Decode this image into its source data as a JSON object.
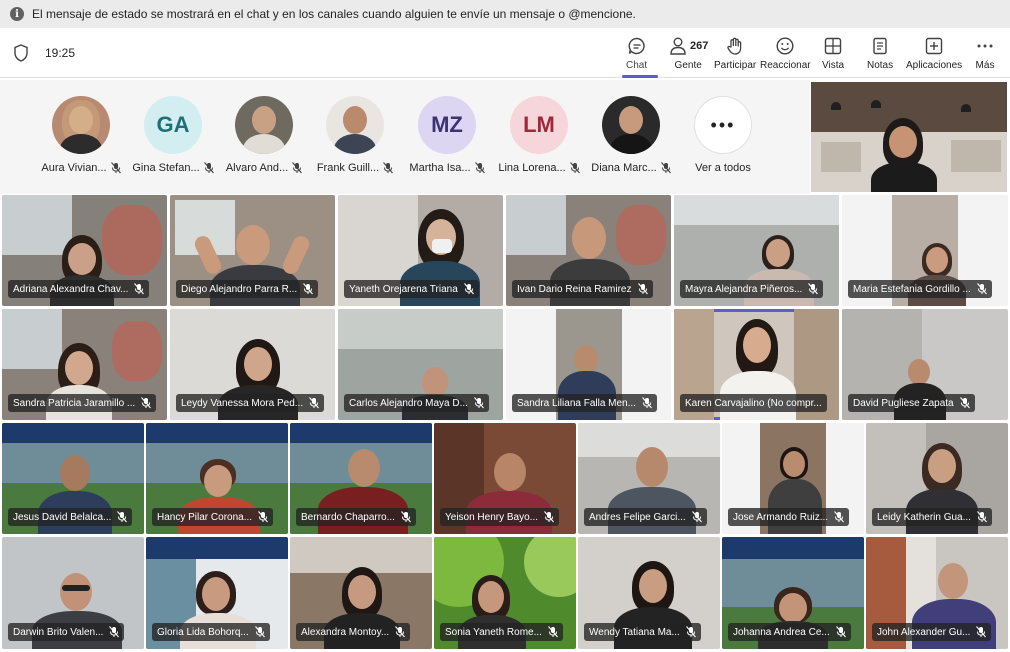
{
  "banner": {
    "text": "El mensaje de estado se mostrará en el chat y en los canales cuando alguien te envíe un mensaje o @mencione.",
    "icon": "info-icon"
  },
  "toolbar": {
    "time": "19:25",
    "buttons": [
      {
        "id": "chat",
        "label": "Chat",
        "icon": "chat-icon",
        "active": true
      },
      {
        "id": "people",
        "label": "Gente",
        "icon": "people-icon",
        "count": "267"
      },
      {
        "id": "participate",
        "label": "Participar",
        "icon": "hand-icon"
      },
      {
        "id": "react",
        "label": "Reaccionar",
        "icon": "smile-icon"
      },
      {
        "id": "view",
        "label": "Vista",
        "icon": "grid-icon"
      },
      {
        "id": "notes",
        "label": "Notas",
        "icon": "notes-icon"
      },
      {
        "id": "apps",
        "label": "Aplicaciones",
        "icon": "plus-icon"
      },
      {
        "id": "more",
        "label": "Más",
        "icon": "more-icon"
      }
    ]
  },
  "strip": {
    "participants": [
      {
        "name": "Aura Vivian...",
        "initials": "",
        "photo": true
      },
      {
        "name": "Gina Stefan...",
        "initials": "GA",
        "photo": false,
        "bg": "#d3eef0",
        "fg": "#1f6f78"
      },
      {
        "name": "Alvaro And...",
        "initials": "",
        "photo": true
      },
      {
        "name": "Frank Guill...",
        "initials": "",
        "photo": true
      },
      {
        "name": "Martha Isa...",
        "initials": "MZ",
        "photo": false,
        "bg": "#dcd6f2",
        "fg": "#3c3373"
      },
      {
        "name": "Lina Lorena...",
        "initials": "LM",
        "photo": false,
        "bg": "#f6d6da",
        "fg": "#a0283b"
      },
      {
        "name": "Diana Marc...",
        "initials": "",
        "photo": true
      }
    ],
    "see_all": "Ver a todos"
  },
  "tiles": {
    "row1": [
      "Adriana Alexandra Chav...",
      "Diego Alejandro Parra R...",
      "Yaneth Orejarena Triana",
      "Ivan Dario Reina Ramirez",
      "Mayra Alejandra Piñeros...",
      "Maria Estefania Gordillo ..."
    ],
    "row2": [
      "Sandra Patricia Jaramillo ...",
      "Leydy Vanessa Mora Ped...",
      "Carlos Alejandro Maya D...",
      "Sandra Liliana Falla Men...",
      "Karen Carvajalino (No compr...",
      "David Pugliese Zapata"
    ],
    "row3": [
      "Jesus David Belalca...",
      "Hancy Pilar Corona...",
      "Bernardo Chaparro...",
      "Yeison Henry Bayo...",
      "Andres Felipe Garci...",
      "Jose Armando Ruiz...",
      "Leidy Katherin Gua..."
    ],
    "row4": [
      "Darwin Brito Valen...",
      "Gloria Lida Bohorq...",
      "Alexandra Montoy...",
      "Sonia Yaneth Rome...",
      "Wendy Tatiana Ma...",
      "Johanna Andrea Ce...",
      "John Alexander Gu..."
    ]
  },
  "colors": {
    "accent": "#5b5fc7",
    "banner_bg": "#ebebeb",
    "name_tag": "#232323"
  }
}
